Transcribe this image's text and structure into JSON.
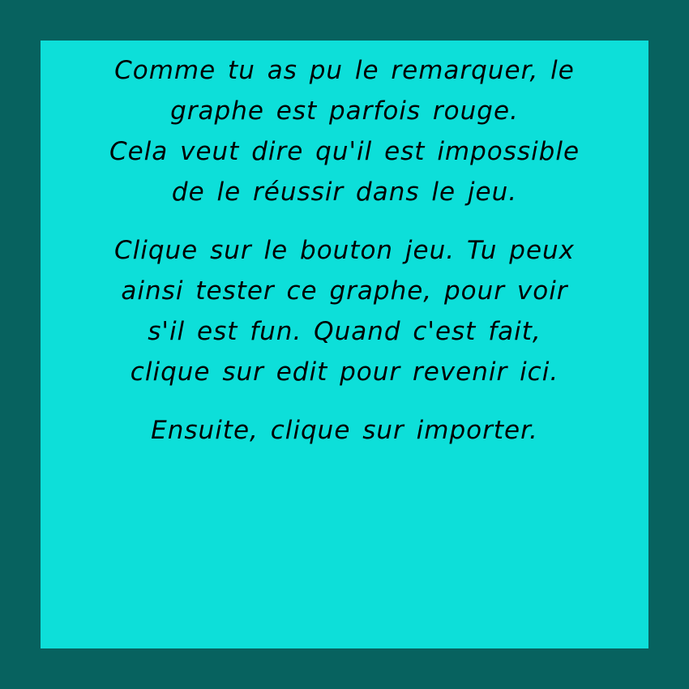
{
  "colors": {
    "frame": "#07625f",
    "panel": "#0ddfd9",
    "text": "#000000"
  },
  "dialog": {
    "paragraph_1": {
      "line_1": "Comme tu as pu le remarquer, le",
      "line_2": "graphe est parfois rouge.",
      "line_3": "Cela veut dire qu'il est impossible",
      "line_4": "de le réussir dans le jeu."
    },
    "paragraph_2": {
      "line_1": "Clique sur le bouton jeu. Tu peux",
      "line_2": "ainsi tester ce graphe, pour voir",
      "line_3": "s'il est fun. Quand c'est fait,",
      "line_4": "clique sur edit pour revenir ici."
    },
    "paragraph_3": {
      "line_1": "Ensuite, clique sur importer."
    }
  }
}
